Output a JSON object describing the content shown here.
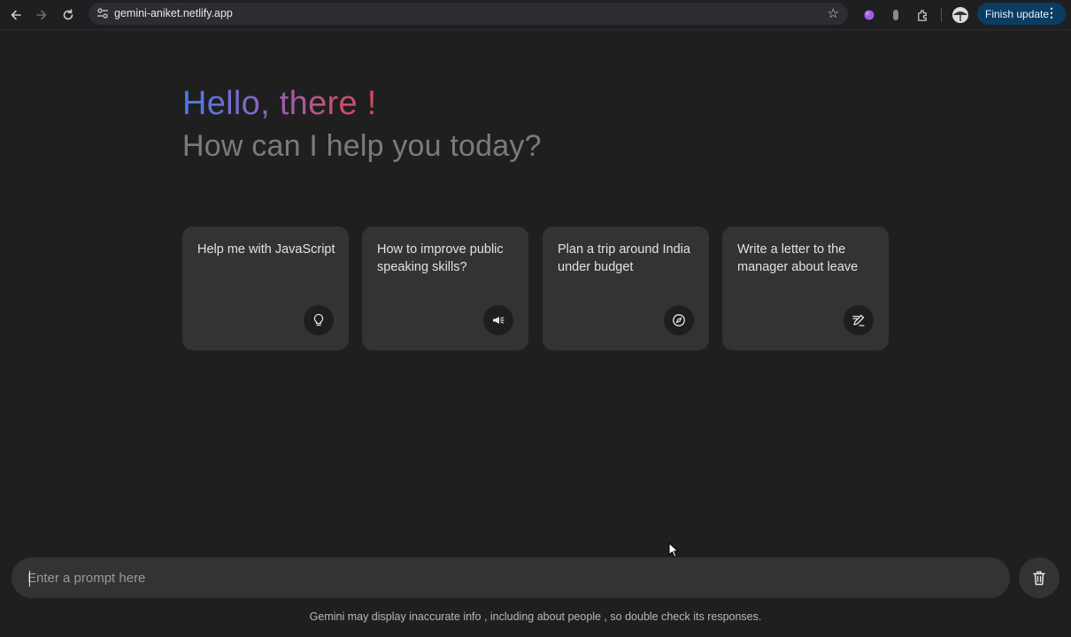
{
  "browser": {
    "url": "gemini-aniket.netlify.app",
    "finish_update_label": "Finish update",
    "back_icon": "arrow-left-icon",
    "forward_icon": "arrow-right-icon",
    "reload_icon": "reload-icon",
    "star_icon": "star-icon"
  },
  "header": {
    "greeting": "Hello, there !",
    "subtitle": "How can I help you today?"
  },
  "suggestions": [
    {
      "text": "Help me with JavaScript",
      "icon": "lightbulb-icon"
    },
    {
      "text": "How to improve public speaking skills?",
      "icon": "megaphone-icon"
    },
    {
      "text": "Plan a trip around India under budget",
      "icon": "compass-icon"
    },
    {
      "text": "Write a letter to the manager about leave",
      "icon": "edit-note-icon"
    }
  ],
  "prompt": {
    "placeholder": "Enter a prompt here",
    "value": ""
  },
  "delete_icon": "trash-icon",
  "disclaimer": "Gemini may display inaccurate info , including about people , so double check its responses.",
  "colors": {
    "background": "#1f1f1f",
    "card": "#333335",
    "greeting_gradient_start": "#4b79e8",
    "greeting_gradient_end": "#d8485c",
    "subtitle": "#7b7b7b",
    "update_button": "#0b3d63"
  }
}
